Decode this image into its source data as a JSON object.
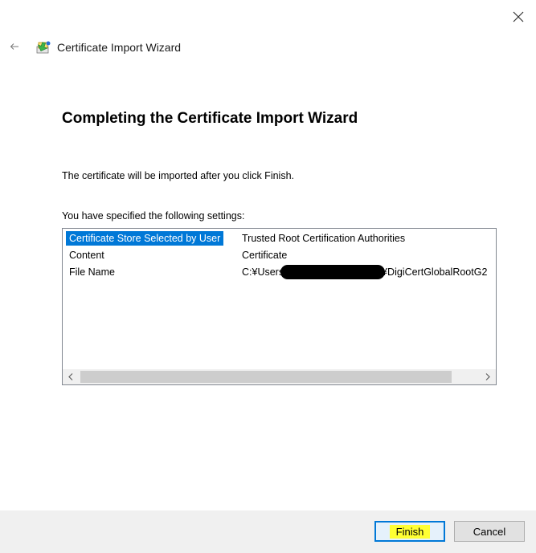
{
  "window": {
    "title": "Certificate Import Wizard",
    "close_icon": "close-icon",
    "back_icon": "back-arrow-icon",
    "app_icon": "certificate-wizard-icon"
  },
  "main": {
    "heading": "Completing the Certificate Import Wizard",
    "intro": "The certificate will be imported after you click Finish.",
    "settings_label": "You have specified the following settings:"
  },
  "settings": {
    "rows": [
      {
        "key": "Certificate Store Selected by User",
        "value": "Trusted Root Certification Authorities"
      },
      {
        "key": "Content",
        "value": "Certificate"
      },
      {
        "key": "File Name",
        "value_prefix": "C:¥Users",
        "value_suffix": "¥DigiCertGlobalRootG2"
      }
    ],
    "selected_row": 0
  },
  "scrollbar": {
    "left_icon": "chevron-left-icon",
    "right_icon": "chevron-right-icon"
  },
  "footer": {
    "finish_label": "Finish",
    "cancel_label": "Cancel",
    "highlight_color": "#ffff33"
  },
  "colors": {
    "selection": "#0078d7",
    "footer_bg": "#f0f0f0"
  }
}
